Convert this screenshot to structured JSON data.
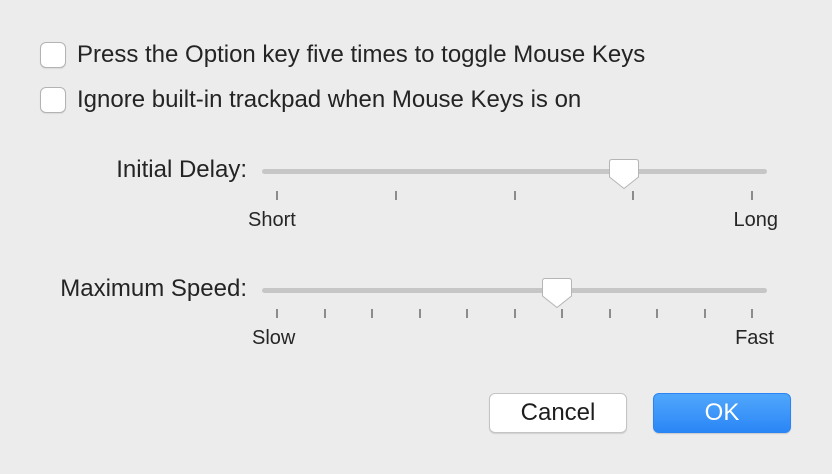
{
  "options": {
    "toggle_mouse_keys": {
      "label": "Press the Option key five times to toggle Mouse Keys",
      "checked": false
    },
    "ignore_trackpad": {
      "label": "Ignore built-in trackpad when Mouse Keys is on",
      "checked": false
    }
  },
  "initial_delay": {
    "label": "Initial Delay:",
    "min_label": "Short",
    "max_label": "Long",
    "tick_count": 5,
    "value_fraction": 0.73
  },
  "maximum_speed": {
    "label": "Maximum Speed:",
    "min_label": "Slow",
    "max_label": "Fast",
    "tick_count": 11,
    "value_fraction": 0.59
  },
  "buttons": {
    "cancel": "Cancel",
    "ok": "OK"
  },
  "colors": {
    "accent": "#2b86f6",
    "background": "#ececec"
  }
}
